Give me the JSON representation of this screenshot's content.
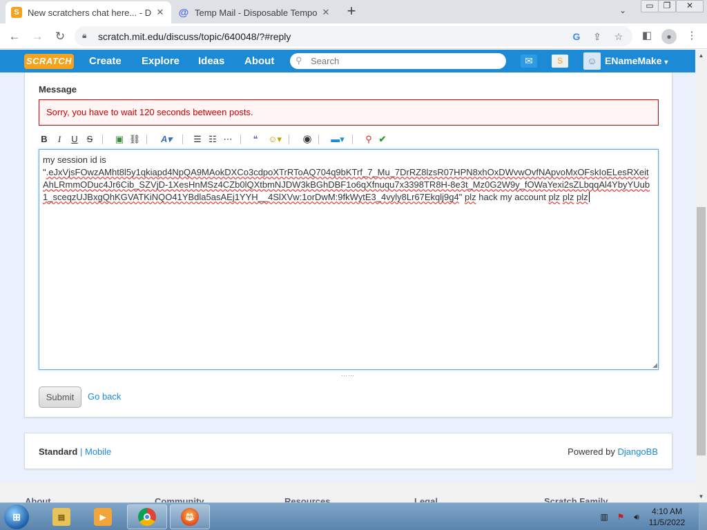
{
  "browser": {
    "tabs": [
      {
        "title": "New scratchers chat here... - Disc",
        "favicon": "S",
        "active": true
      },
      {
        "title": "Temp Mail - Disposable Tempora",
        "favicon": "@",
        "active": false
      }
    ],
    "new_tab": "+",
    "tab_menu": "⌄",
    "window_controls": [
      "▭",
      "❐",
      "✕"
    ],
    "url": "scratch.mit.edu/discuss/topic/640048/?#reply",
    "icons": [
      "back-icon",
      "forward-icon",
      "reload-icon",
      "lock-icon",
      "google-icon",
      "share-icon",
      "star-icon",
      "sidepanel-icon",
      "profile-icon",
      "menu-icon"
    ]
  },
  "scratch_nav": {
    "logo": "SCRATCH",
    "links": [
      "Create",
      "Explore",
      "Ideas",
      "About"
    ],
    "search_placeholder": "Search",
    "username": "ENameMake",
    "caret": "▾",
    "colors": {
      "nav": "#1c8ad4",
      "logo": "#f6a21c"
    }
  },
  "reply": {
    "label": "Message",
    "error": "Sorry, you have to wait 120 seconds between posts.",
    "toolbar": {
      "bold": "B",
      "italic": "I",
      "underline": "U",
      "strike": "S",
      "font_color": "A"
    },
    "text": {
      "line1": "my session id is",
      "token_part1": "\"",
      "token": ".eJxVjsFOwzAMht8l5y1qkiapd4NpQA9MAokDXCo3cdpoXTrRToAQ704q9bKTrf_7_Mu_7DrRZ8lzsR07HPN8xhOxDWvwOvfNApvoMxOFskIoELesRXeitAhLRmmODuc4Jr6Cib_SZVjD-1XesHnMSz4CZb0lQXtbmNJDW3kBGhDBF1o6qXfnuqu7x3398TR8H-8e3t_Mz0G2W9y_fOWaYexi2sZLbqqAl4YbyYUub1_sceqzUJBxgQhKGVATKiNQO41YBdla5asAEj1YYH__4SlXVw:1orDwM:9fkWytE3_4vyly8Lr67Ekqlj9g4",
      "closing_quote": "\"",
      "tail_words": [
        "plz",
        "hack",
        "my",
        "account",
        "plz",
        "plz",
        "plz"
      ]
    },
    "submit": "Submit",
    "go_back": "Go back"
  },
  "footer_strip": {
    "standard": "Standard",
    "separator": "|",
    "mobile": "Mobile",
    "powered_by": "Powered by",
    "djangobb": "DjangoBB"
  },
  "site_footer": {
    "columns": [
      "About",
      "Community",
      "Resources",
      "Legal",
      "Scratch Family"
    ]
  },
  "taskbar": {
    "apps": [
      "start-icon",
      "file-explorer-icon",
      "media-player-icon",
      "chrome-icon",
      "firefox-icon"
    ],
    "tray": [
      "network-icon",
      "flag-icon",
      "volume-icon"
    ],
    "time": "4:10 AM",
    "date": "11/5/2022"
  }
}
